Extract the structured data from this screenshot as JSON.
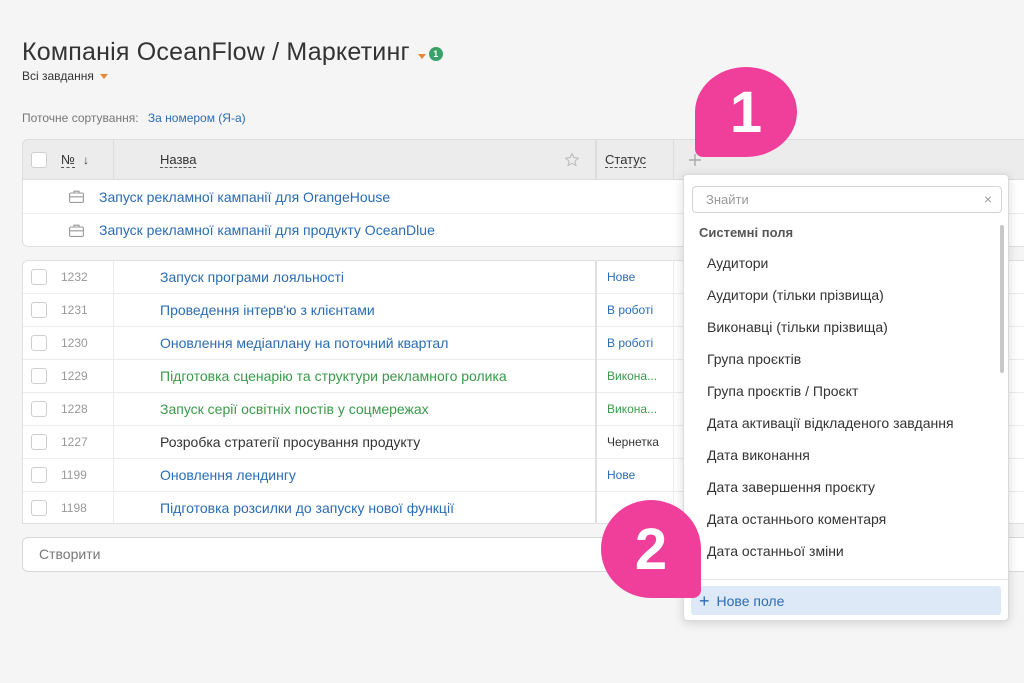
{
  "header": {
    "title": "Компанія OceanFlow / Маркетинг",
    "badge": "1",
    "filter": "Всі завдання"
  },
  "sort": {
    "label": "Поточне сортування:",
    "value": "За номером (Я-а)"
  },
  "table": {
    "columns": {
      "number": "№",
      "number_sort_arrow": "↓",
      "name": "Назва",
      "status": "Статус"
    },
    "groups": [
      {
        "name": "Запуск рекламної кампанії для OrangeHouse"
      },
      {
        "name": "Запуск рекламної кампанії для продукту OceanDlue"
      }
    ],
    "rows": [
      {
        "id": "1232",
        "name": "Запуск програми лояльності",
        "status": "Нове",
        "name_color": "#2a6cb5",
        "status_color": "#2a6cb5"
      },
      {
        "id": "1231",
        "name": "Проведення інтерв'ю з клієнтами",
        "status": "В роботі",
        "name_color": "#2a6cb5",
        "status_color": "#2a6cb5"
      },
      {
        "id": "1230",
        "name": "Оновлення медіаплану на поточний квартал",
        "status": "В роботі",
        "name_color": "#2a6cb5",
        "status_color": "#2a6cb5"
      },
      {
        "id": "1229",
        "name": "Підготовка сценарію та структури рекламного ролика",
        "status": "Викона...",
        "name_color": "#3a9a4a",
        "status_color": "#3a9a4a"
      },
      {
        "id": "1228",
        "name": "Запуск серії освітніх постів у соцмережах",
        "status": "Викона...",
        "name_color": "#3a9a4a",
        "status_color": "#3a9a4a"
      },
      {
        "id": "1227",
        "name": "Розробка стратегії просування продукту",
        "status": "Чернетка",
        "name_color": "#333333",
        "status_color": "#333333"
      },
      {
        "id": "1199",
        "name": "Оновлення лендингу",
        "status": "Нове",
        "name_color": "#2a6cb5",
        "status_color": "#2a6cb5"
      },
      {
        "id": "1198",
        "name": "Підготовка розсилки до запуску нової функції",
        "status": "",
        "name_color": "#2a6cb5",
        "status_color": "#2a6cb5"
      }
    ]
  },
  "create": {
    "placeholder": "Створити"
  },
  "dropdown": {
    "search_placeholder": "Знайти",
    "clear": "×",
    "section": "Системні поля",
    "items": [
      "Аудитори",
      "Аудитори (тільки прізвища)",
      "Виконавці (тільки прізвища)",
      "Група проєктів",
      "Група проєктів / Проєкт",
      "Дата активації відкладеного завдання",
      "Дата виконання",
      "Дата завершення проєкту",
      "Дата останнього коментаря",
      "Дата останньої зміни"
    ],
    "new_field": "Нове поле"
  },
  "markers": {
    "first": "1",
    "second": "2"
  },
  "colors": {
    "link": "#2a6cb5",
    "done": "#3a9a4a",
    "accent_caret": "#e8863a",
    "badge": "#3ca06a",
    "marker": "#ef3f9a",
    "new_field_bg": "#dde9f7"
  },
  "icons": {
    "star": "star-icon",
    "plus": "plus-icon",
    "briefcase": "briefcase-icon",
    "clear": "close-icon"
  }
}
